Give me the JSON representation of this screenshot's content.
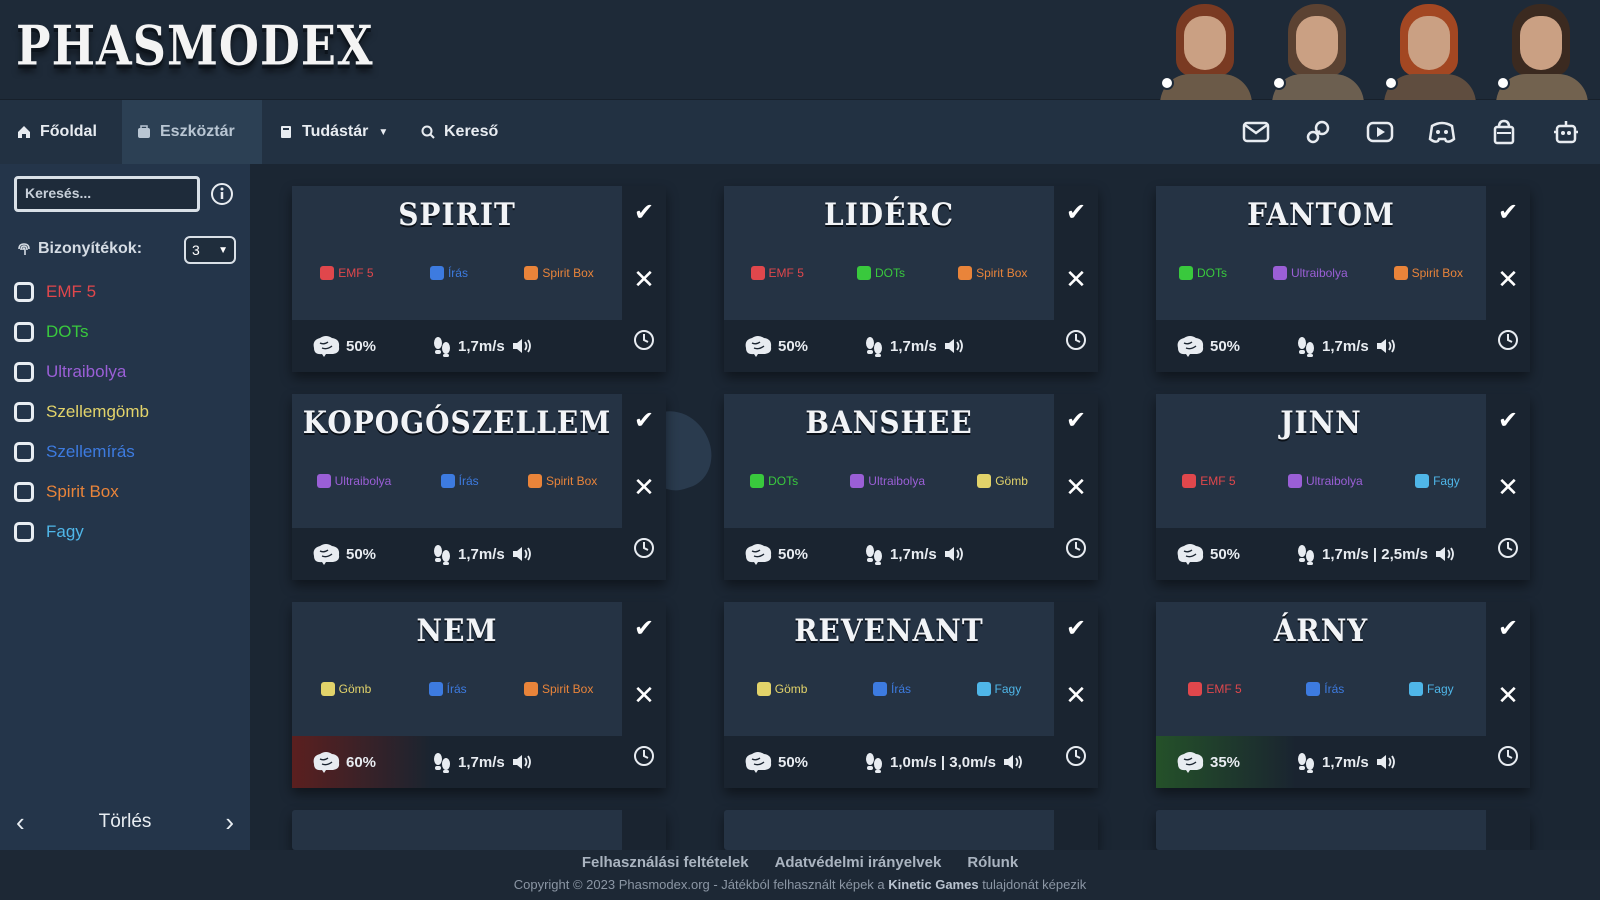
{
  "header": {
    "logo": "PHASMODEX",
    "avatars": [
      {
        "name": "avatar-1",
        "hair": "#7a3a22",
        "body": "#6b5a48"
      },
      {
        "name": "avatar-2",
        "hair": "#5b4232",
        "body": "#6c5f50"
      },
      {
        "name": "avatar-3",
        "hair": "#a34722",
        "body": "#5f4d3f"
      },
      {
        "name": "avatar-4",
        "hair": "#3b2a20",
        "body": "#72624f"
      }
    ]
  },
  "nav": {
    "home": "Főoldal",
    "tools": "Eszköztár",
    "knowledge": "Tudástár",
    "search": "Kereső",
    "icons": [
      "mail-icon",
      "steam-icon",
      "youtube-icon",
      "discord-icon",
      "store-icon",
      "bot-icon"
    ]
  },
  "sidebar": {
    "search_placeholder": "Keresés...",
    "evidence_title": "Bizonyítékok:",
    "evidence_count": "3",
    "evidences": [
      {
        "label": "EMF 5",
        "color": "#e0474c"
      },
      {
        "label": "DOTs",
        "color": "#39c93d"
      },
      {
        "label": "Ultraibolya",
        "color": "#9a5fd6"
      },
      {
        "label": "Szellemgömb",
        "color": "#e2d36a"
      },
      {
        "label": "Szellemírás",
        "color": "#3d7be0"
      },
      {
        "label": "Spirit Box",
        "color": "#e9843a"
      },
      {
        "label": "Fagy",
        "color": "#4fb6e8"
      }
    ],
    "clear": "Törlés"
  },
  "ghosts": [
    {
      "name": "SPIRIT",
      "evidence": [
        {
          "label": "EMF 5",
          "color": "#e0474c"
        },
        {
          "label": "Írás",
          "color": "#3d7be0"
        },
        {
          "label": "Spirit Box",
          "color": "#e9843a"
        }
      ],
      "sanity": "50%",
      "speed": "1,7m/s",
      "tint": ""
    },
    {
      "name": "LIDÉRC",
      "evidence": [
        {
          "label": "EMF 5",
          "color": "#e0474c"
        },
        {
          "label": "DOTs",
          "color": "#39c93d"
        },
        {
          "label": "Spirit Box",
          "color": "#e9843a"
        }
      ],
      "sanity": "50%",
      "speed": "1,7m/s",
      "tint": ""
    },
    {
      "name": "FANTOM",
      "evidence": [
        {
          "label": "DOTs",
          "color": "#39c93d"
        },
        {
          "label": "Ultraibolya",
          "color": "#9a5fd6"
        },
        {
          "label": "Spirit Box",
          "color": "#e9843a"
        }
      ],
      "sanity": "50%",
      "speed": "1,7m/s",
      "tint": ""
    },
    {
      "name": "KOPOGÓSZELLEM",
      "evidence": [
        {
          "label": "Ultraibolya",
          "color": "#9a5fd6"
        },
        {
          "label": "Írás",
          "color": "#3d7be0"
        },
        {
          "label": "Spirit Box",
          "color": "#e9843a"
        }
      ],
      "sanity": "50%",
      "speed": "1,7m/s",
      "tint": ""
    },
    {
      "name": "BANSHEE",
      "evidence": [
        {
          "label": "DOTs",
          "color": "#39c93d"
        },
        {
          "label": "Ultraibolya",
          "color": "#9a5fd6"
        },
        {
          "label": "Gömb",
          "color": "#e2d36a"
        }
      ],
      "sanity": "50%",
      "speed": "1,7m/s",
      "tint": ""
    },
    {
      "name": "JINN",
      "evidence": [
        {
          "label": "EMF 5",
          "color": "#e0474c"
        },
        {
          "label": "Ultraibolya",
          "color": "#9a5fd6"
        },
        {
          "label": "Fagy",
          "color": "#4fb6e8"
        }
      ],
      "sanity": "50%",
      "speed": "1,7m/s | 2,5m/s",
      "tint": ""
    },
    {
      "name": "NEM",
      "evidence": [
        {
          "label": "Gömb",
          "color": "#e2d36a"
        },
        {
          "label": "Írás",
          "color": "#3d7be0"
        },
        {
          "label": "Spirit Box",
          "color": "#e9843a"
        }
      ],
      "sanity": "60%",
      "speed": "1,7m/s",
      "tint": "red"
    },
    {
      "name": "REVENANT",
      "evidence": [
        {
          "label": "Gömb",
          "color": "#e2d36a"
        },
        {
          "label": "Írás",
          "color": "#3d7be0"
        },
        {
          "label": "Fagy",
          "color": "#4fb6e8"
        }
      ],
      "sanity": "50%",
      "speed": "1,0m/s | 3,0m/s",
      "tint": ""
    },
    {
      "name": "ÁRNY",
      "evidence": [
        {
          "label": "EMF 5",
          "color": "#e0474c"
        },
        {
          "label": "Írás",
          "color": "#3d7be0"
        },
        {
          "label": "Fagy",
          "color": "#4fb6e8"
        }
      ],
      "sanity": "35%",
      "speed": "1,7m/s",
      "tint": "green"
    }
  ],
  "footer": {
    "terms": "Felhasználási feltételek",
    "privacy": "Adatvédelmi irányelvek",
    "about": "Rólunk",
    "copyright_pre": "Copyright © 2023 Phasmodex.org  -  Játékból felhasznált képek a ",
    "copyright_brand": "Kinetic Games",
    "copyright_post": " tulajdonát képezik"
  }
}
